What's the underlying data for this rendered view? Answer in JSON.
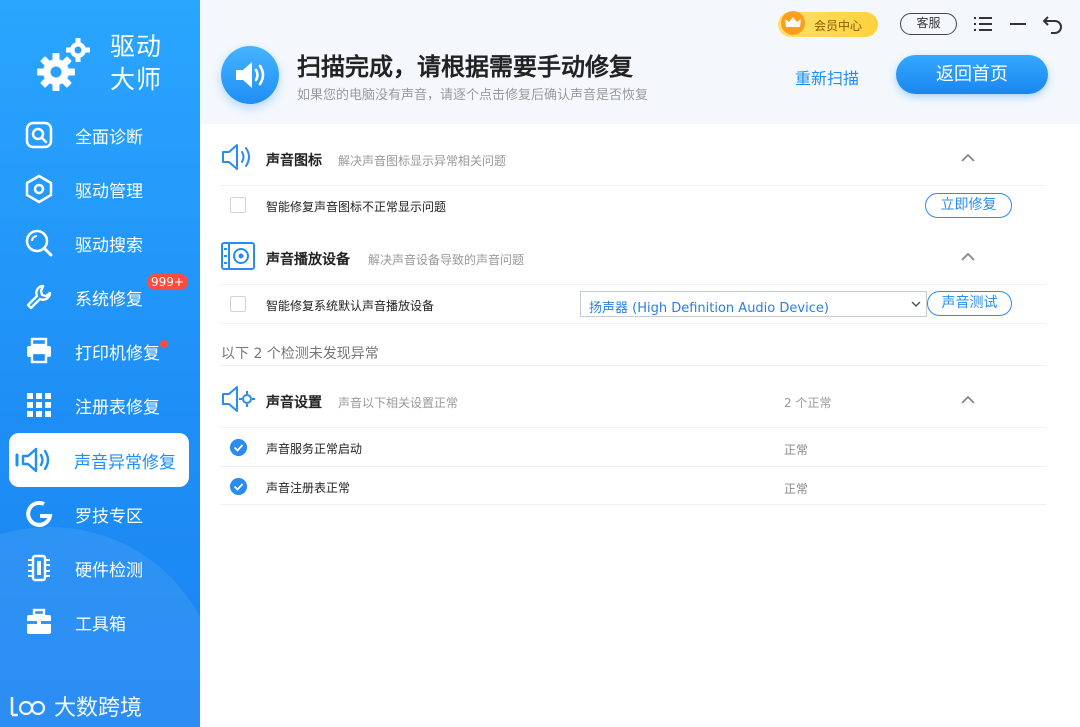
{
  "sidebar": {
    "brand": "驱动大师",
    "brand_line1": "驱动",
    "brand_line2": "大师",
    "items": [
      {
        "label": "全面诊断",
        "icon": "search-icon"
      },
      {
        "label": "驱动管理",
        "icon": "hexagon-icon"
      },
      {
        "label": "驱动搜索",
        "icon": "magnifier-icon"
      },
      {
        "label": "系统修复",
        "icon": "wrench-icon",
        "badge": "999+"
      },
      {
        "label": "打印机修复",
        "icon": "printer-icon",
        "dot": true
      },
      {
        "label": "注册表修复",
        "icon": "grid-icon"
      },
      {
        "label": "声音异常修复",
        "icon": "speaker-icon",
        "active": true
      },
      {
        "label": "罗技专区",
        "icon": "logitech-icon"
      },
      {
        "label": "硬件检测",
        "icon": "chip-icon"
      },
      {
        "label": "工具箱",
        "icon": "toolbox-icon"
      }
    ],
    "watermark": "大数跨境"
  },
  "topbar": {
    "vip_label": "会员中心",
    "service_label": "客服"
  },
  "header": {
    "title": "扫描完成，请根据需要手动修复",
    "subtitle": "如果您的电脑没有声音，请逐个点击修复后确认声音是否恢复",
    "rescan_label": "重新扫描",
    "home_label": "返回首页"
  },
  "sections": {
    "icon": {
      "title": "声音图标",
      "desc": "解决声音图标显示异常相关问题",
      "row_label": "智能修复声音图标不正常显示问题",
      "button": "立即修复"
    },
    "device": {
      "title": "声音播放设备",
      "desc": "解决声音设备导致的声音问题",
      "row_label": "智能修复系统默认声音播放设备",
      "select_value": "扬声器 (High Definition Audio Device)",
      "button": "声音测试"
    },
    "hint": "以下 2 个检测未发现异常",
    "settings": {
      "title": "声音设置",
      "desc": "声音以下相关设置正常",
      "count": "2 个正常",
      "rows": [
        {
          "label": "声音服务正常启动",
          "status": "正常"
        },
        {
          "label": "声音注册表正常",
          "status": "正常"
        }
      ]
    }
  },
  "colors": {
    "accent": "#1e8ff6",
    "sidebar_top": "#2aa6ff",
    "badge": "#ff4d3d",
    "vip": "#ffd23c"
  }
}
